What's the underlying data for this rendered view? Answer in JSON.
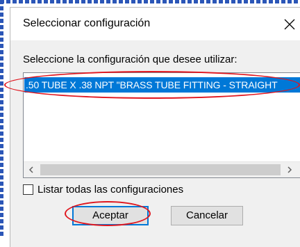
{
  "dialog": {
    "title": "Seleccionar configuración",
    "close_icon": "close-icon",
    "prompt": "Seleccione la configuración que desee utilizar:",
    "list": {
      "items": [
        ".50 TUBE X .38 NPT \"BRASS TUBE FITTING - STRAIGHT"
      ],
      "selected_index": 0
    },
    "checkbox": {
      "label": "Listar todas las configuraciones",
      "checked": false
    },
    "buttons": {
      "ok": "Aceptar",
      "cancel": "Cancelar"
    }
  },
  "colors": {
    "selection": "#0078d7",
    "annotation": "#e0161e",
    "frame": "#2b56b7"
  }
}
